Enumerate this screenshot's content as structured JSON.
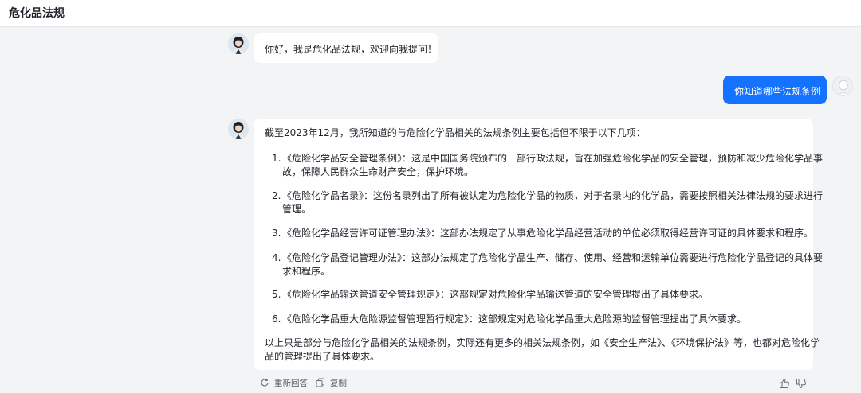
{
  "header": {
    "title": "危化品法规"
  },
  "greeting": {
    "text": "你好，我是危化品法规，欢迎向我提问！"
  },
  "user_message": {
    "text": "你知道哪些法规条例"
  },
  "answer": {
    "intro": "截至2023年12月，我所知道的与危险化学品相关的法规条例主要包括但不限于以下几项：",
    "items": [
      {
        "num": "1.",
        "lines": [
          "《危险化学品安全管理条例》：这是中国国务院颁布的一部行政法规，旨在加强危险化学品的安全管理，预防和减少危险化学品事",
          "故，保障人民群众生命财产安全，保护环境。"
        ]
      },
      {
        "num": "2.",
        "lines": [
          "《危险化学品名录》：这份名录列出了所有被认定为危险化学品的物质，对于名录内的化学品，需要按照相关法律法规的要求进行",
          "管理。"
        ]
      },
      {
        "num": "3.",
        "lines": [
          "《危险化学品经营许可证管理办法》：这部办法规定了从事危险化学品经营活动的单位必须取得经营许可证的具体要求和程序。"
        ]
      },
      {
        "num": "4.",
        "lines": [
          "《危险化学品登记管理办法》：这部办法规定了危险化学品生产、储存、使用、经营和运输单位需要进行危险化学品登记的具体要",
          "求和程序。"
        ]
      },
      {
        "num": "5.",
        "lines": [
          "《危险化学品输送管道安全管理规定》：这部规定对危险化学品输送管道的安全管理提出了具体要求。"
        ]
      },
      {
        "num": "6.",
        "lines": [
          "《危险化学品重大危险源监督管理暂行规定》：这部规定对危险化学品重大危险源的监督管理提出了具体要求。"
        ]
      }
    ],
    "outro": [
      "以上只是部分与危险化学品相关的法规条例，实际还有更多的相关法规条例，如《安全生产法》、《环境保护法》等，也都对危险化学",
      "品的管理提出了具体要求。"
    ]
  },
  "actions": {
    "regenerate_label": "重新回答",
    "copy_label": "复制",
    "regenerate_icon": "refresh-icon",
    "copy_icon": "copy-icon",
    "like_icon": "thumbs-up-icon",
    "dislike_icon": "thumbs-down-icon"
  },
  "colors": {
    "user_bubble": "#1472ff",
    "background": "#f3f4f6",
    "bubble": "#ffffff"
  }
}
